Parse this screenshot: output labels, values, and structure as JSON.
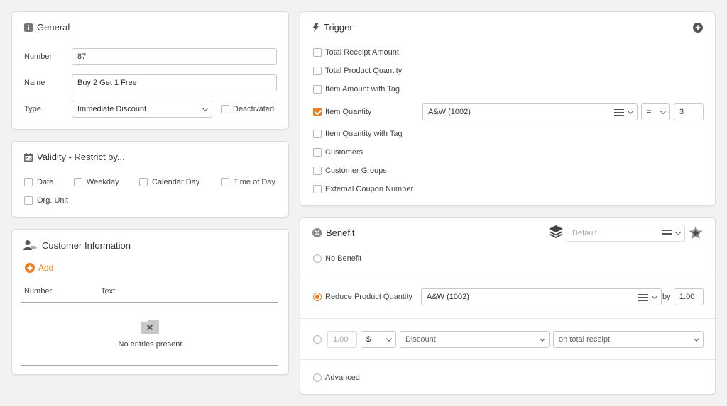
{
  "general": {
    "title": "General",
    "number_label": "Number",
    "number_value": "87",
    "name_label": "Name",
    "name_value": "Buy 2 Get 1 Free",
    "type_label": "Type",
    "type_value": "Immediate Discount",
    "deactivated_label": "Deactivated"
  },
  "validity": {
    "title": "Validity - Restrict by...",
    "options": [
      "Date",
      "Weekday",
      "Calendar Day",
      "Time of Day",
      "Org. Unit"
    ]
  },
  "customer_info": {
    "title": "Customer Information",
    "add_label": "Add",
    "columns": [
      "Number",
      "Text"
    ],
    "empty_text": "No entries present"
  },
  "trigger": {
    "title": "Trigger",
    "options": [
      {
        "label": "Total Receipt Amount",
        "checked": false
      },
      {
        "label": "Total Product Quantity",
        "checked": false
      },
      {
        "label": "Item Amount with Tag",
        "checked": false
      },
      {
        "label": "Item Quantity",
        "checked": true
      },
      {
        "label": "Item Quantity with Tag",
        "checked": false
      },
      {
        "label": "Customers",
        "checked": false
      },
      {
        "label": "Customer Groups",
        "checked": false
      },
      {
        "label": "External Coupon Number",
        "checked": false
      }
    ],
    "item_value": "A&W (1002)",
    "operator": "=",
    "quantity": "3"
  },
  "benefit": {
    "title": "Benefit",
    "default_placeholder": "Default",
    "no_benefit_label": "No Benefit",
    "reduce_label": "Reduce Product Quantity",
    "reduce_item": "A&W (1002)",
    "by_label": "by",
    "by_value": "1.00",
    "amount_placeholder": "1.00",
    "currency": "$",
    "discount_value": "Discount",
    "scope_value": "on total receipt",
    "advanced_label": "Advanced"
  },
  "colors": {
    "accent": "#ef7d22",
    "panel_bg": "#ffffff",
    "page_bg": "#f2f2f2"
  }
}
